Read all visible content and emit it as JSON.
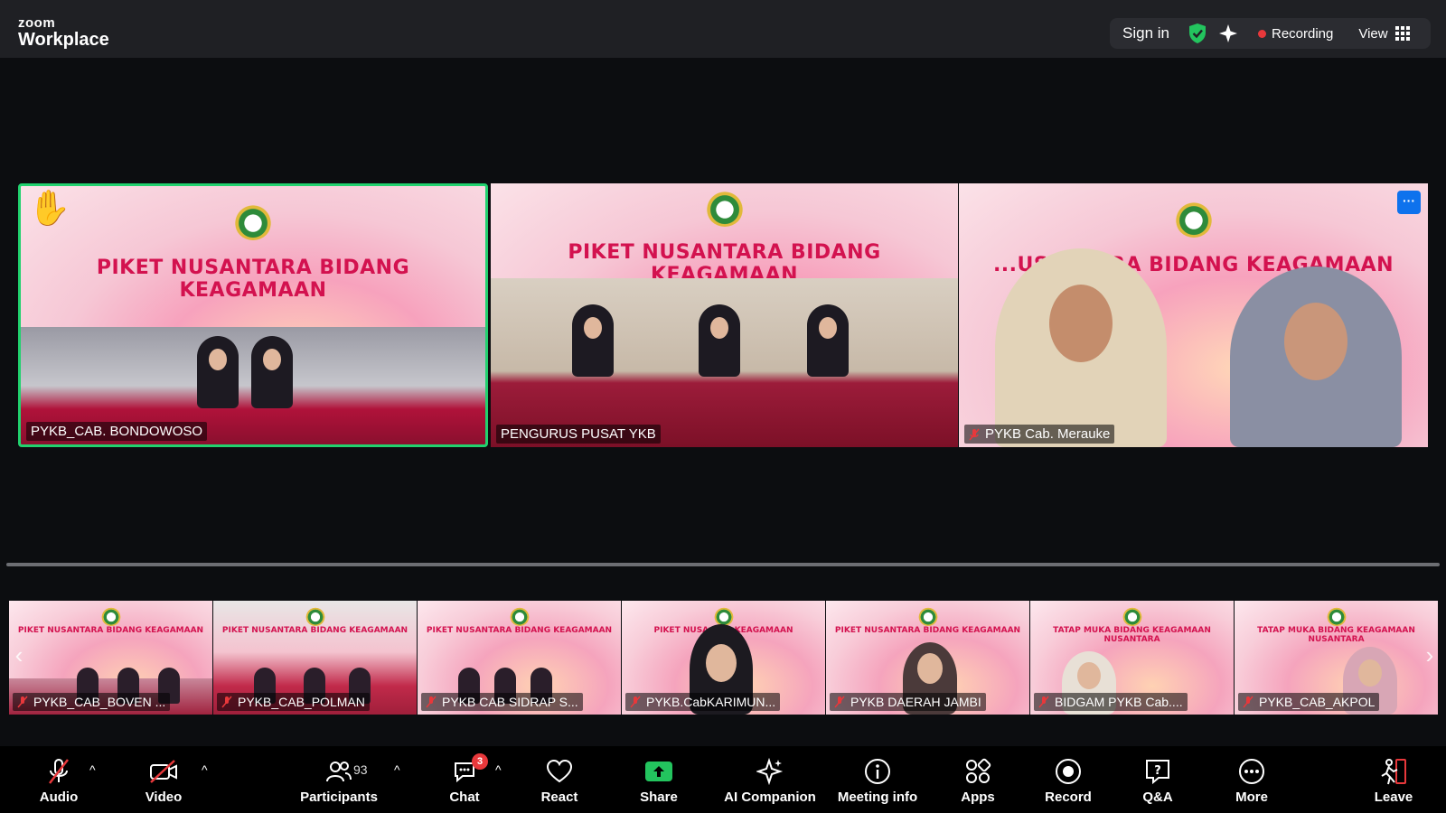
{
  "app": {
    "logo_line1": "zoom",
    "logo_line2": "Workplace"
  },
  "header": {
    "sign_in": "Sign in",
    "recording": "Recording",
    "view": "View"
  },
  "main_tiles": [
    {
      "name": "PYKB_CAB. BONDOWOSO",
      "banner": "PIKET NUSANTARA BIDANG KEAGAMAAN",
      "hand_raised": true,
      "muted": false
    },
    {
      "name": "PENGURUS PUSAT YKB",
      "banner": "PIKET NUSANTARA BIDANG KEAGAMAAN",
      "muted": false
    },
    {
      "name": "PYKB Cab. Merauke",
      "banner": "...USANTARA BIDANG KEAGAMAAN",
      "muted": true,
      "more": "···"
    }
  ],
  "strip_tiles": [
    {
      "name": "PYKB_CAB_BOVEN ...",
      "banner": "PIKET NUSANTARA BIDANG KEAGAMAAN"
    },
    {
      "name": "PYKB_CAB_POLMAN",
      "banner": "PIKET NUSANTARA BIDANG KEAGAMAAN"
    },
    {
      "name": "PYKB CAB SIDRAP S...",
      "banner": "PIKET NUSANTARA BIDANG KEAGAMAAN"
    },
    {
      "name": "PYKB.CabKARIMUN...",
      "banner": "PIKET NUSA...NG KEAGAMAAN"
    },
    {
      "name": "PYKB DAERAH JAMBI",
      "banner": "PIKET NUSANTARA BIDANG KEAGAMAAN"
    },
    {
      "name": "BIDGAM PYKB Cab....",
      "banner": "TATAP MUKA BIDANG KEAGAMAAN NUSANTARA"
    },
    {
      "name": "PYKB_CAB_AKPOL",
      "banner": "TATAP MUKA BIDANG KEAGAMAAN NUSANTARA"
    }
  ],
  "strip_nav": {
    "prev": "‹",
    "next": "›"
  },
  "toolbar": {
    "audio": "Audio",
    "video": "Video",
    "participants": "Participants",
    "participants_count": "93",
    "chat": "Chat",
    "chat_badge": "3",
    "react": "React",
    "share": "Share",
    "ai_companion": "AI Companion",
    "meeting_info": "Meeting info",
    "apps": "Apps",
    "record": "Record",
    "qa": "Q&A",
    "more": "More",
    "leave": "Leave"
  },
  "colors": {
    "active_speaker": "#21d16e",
    "accent": "#0e72ed",
    "record_dot": "#e8383b",
    "banner_text": "#d3124f"
  },
  "icons": [
    "shield-check-icon",
    "sparkle-icon",
    "grid-icon",
    "hand-icon",
    "mic-muted-icon",
    "video-off-icon",
    "participants-icon",
    "chat-icon",
    "heart-icon",
    "share-icon",
    "ai-sparkle-icon",
    "info-icon",
    "apps-icon",
    "record-icon",
    "qa-icon",
    "more-icon",
    "leave-icon"
  ]
}
